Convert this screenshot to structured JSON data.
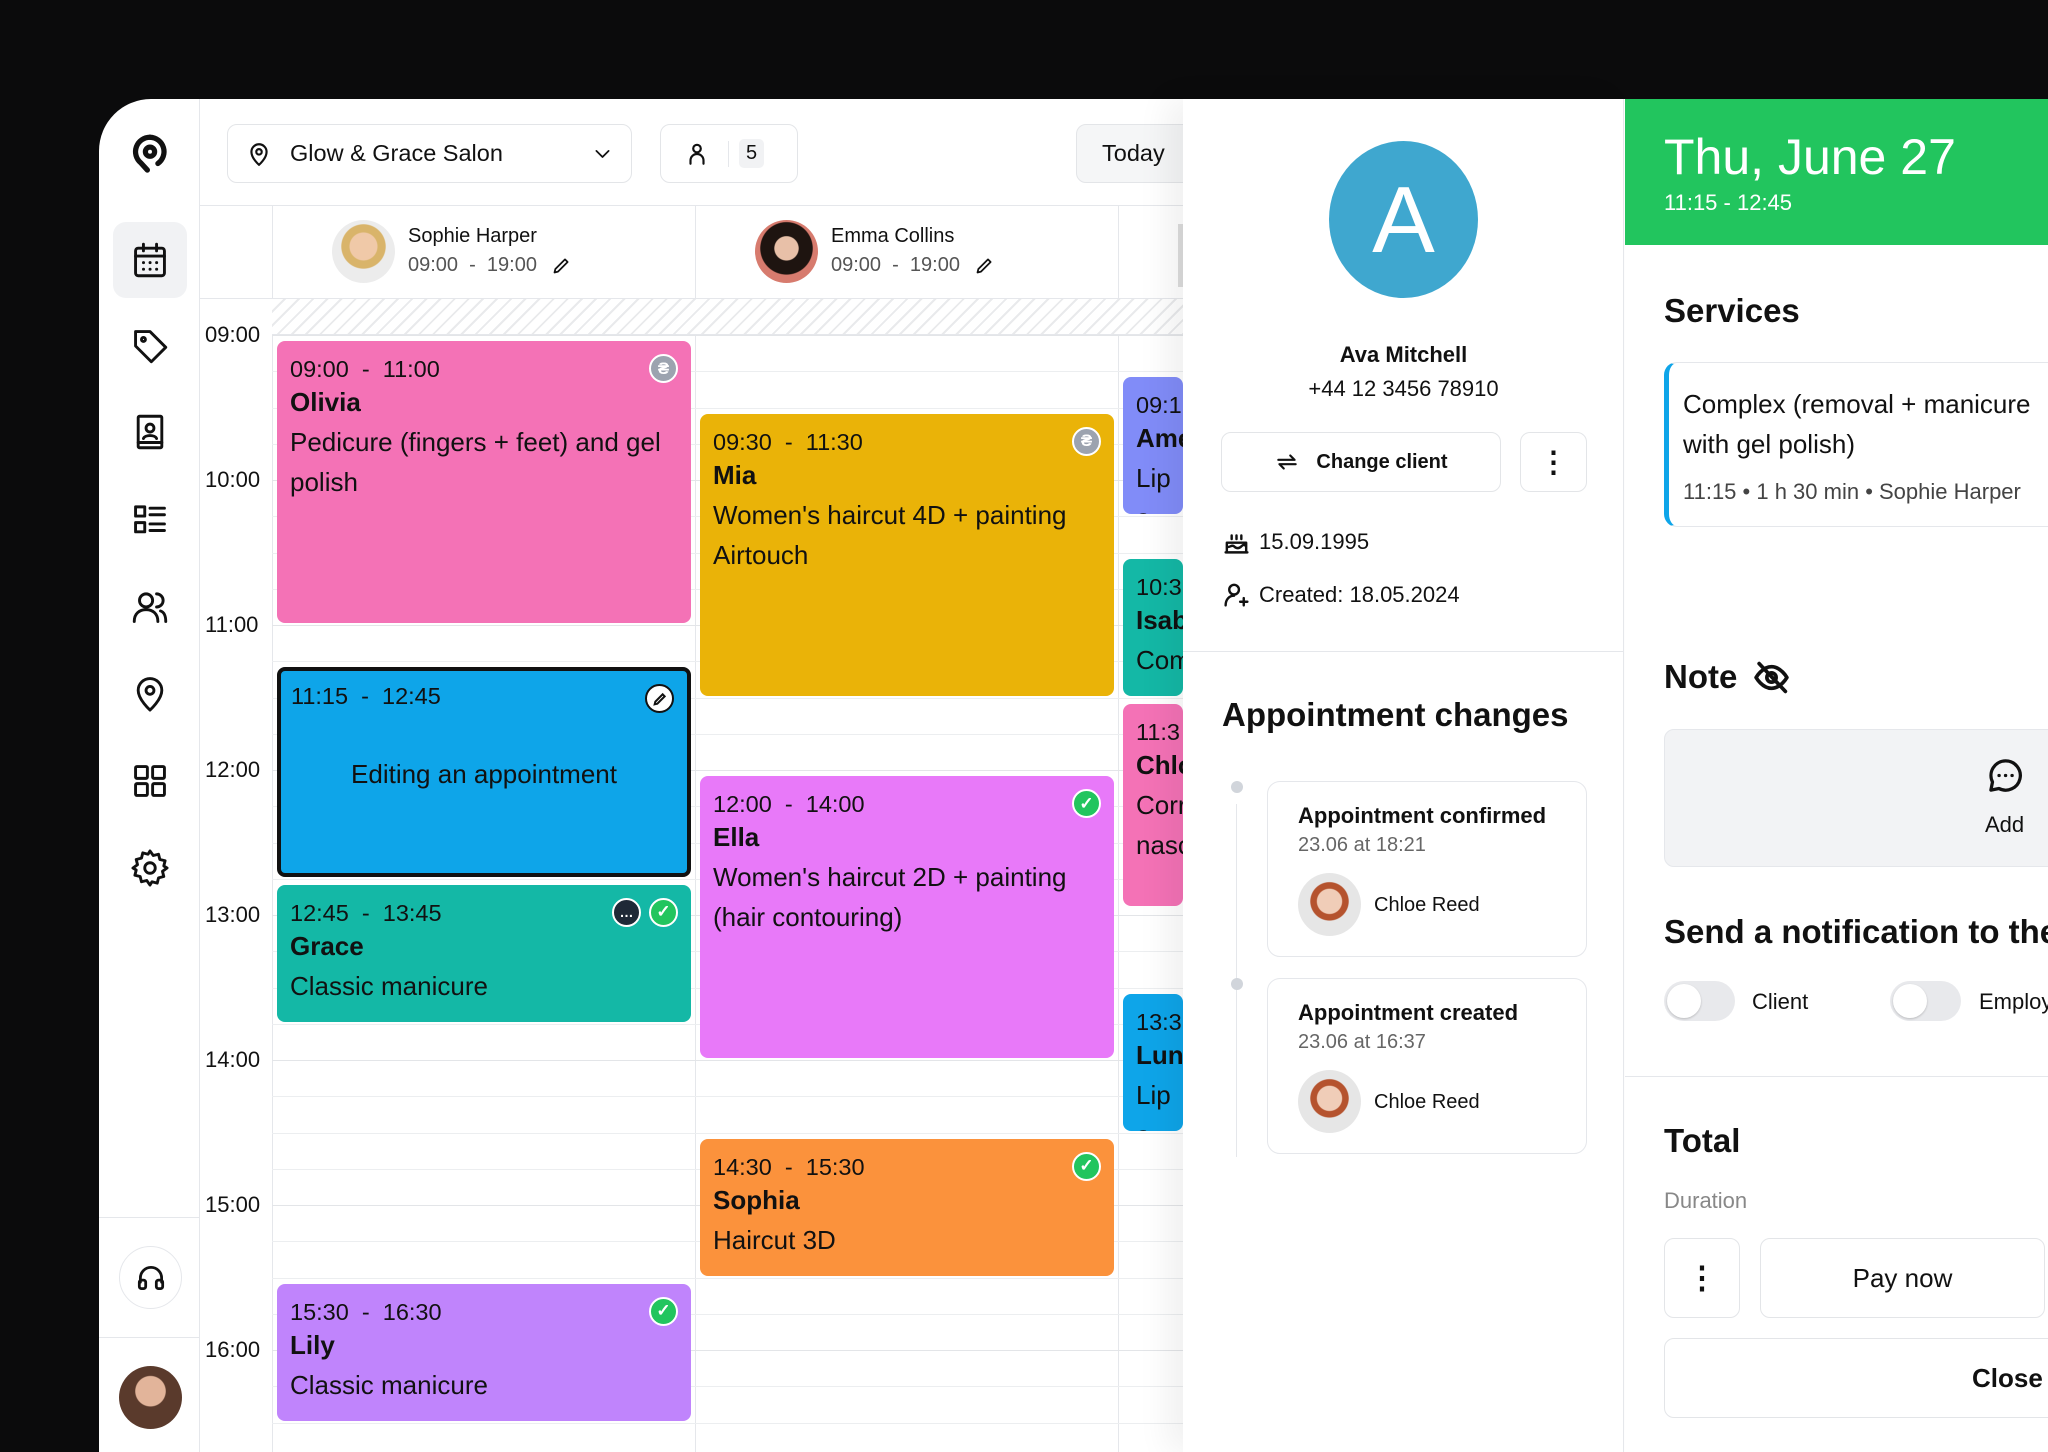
{
  "colors": {
    "background": "#0b0b0c",
    "accent_green": "#22c55e",
    "client_avatar": "#3fa7cf",
    "active_nav_bg": "#f1f2f4"
  },
  "sidebar": {
    "items": [
      {
        "icon": "logo-icon"
      },
      {
        "icon": "calendar-icon",
        "active": true
      },
      {
        "icon": "tag-icon"
      },
      {
        "icon": "contact-book-icon"
      },
      {
        "icon": "services-list-icon"
      },
      {
        "icon": "users-icon"
      },
      {
        "icon": "location-icon"
      },
      {
        "icon": "apps-grid-icon"
      },
      {
        "icon": "gear-icon"
      },
      {
        "icon": "headset-icon"
      },
      {
        "icon": "user-avatar"
      }
    ]
  },
  "toolbar": {
    "location": "Glow & Grace Salon",
    "staff_count": "5",
    "today_label": "Today"
  },
  "staff": [
    {
      "name": "Sophie Harper",
      "hours": "09:00  -  19:00"
    },
    {
      "name": "Emma Collins",
      "hours": "09:00  -  19:00"
    }
  ],
  "time_labels": [
    "09:00",
    "10:00",
    "11:00",
    "12:00",
    "13:00",
    "14:00",
    "15:00",
    "16:00"
  ],
  "events": [
    {
      "col": 0,
      "start": 9,
      "end": 11,
      "time": "09:00  -  11:00",
      "client": "Olivia",
      "service": "Pedicure (fingers + feet) and gel polish",
      "color": "#f472b6",
      "icons": [
        "payment"
      ]
    },
    {
      "col": 0,
      "start": 11.25,
      "end": 12.75,
      "time": "11:15  -  12:45",
      "client": "",
      "service": "Editing an appointment",
      "color": "#0ea5e9",
      "icons": [
        "edit"
      ],
      "editing": true
    },
    {
      "col": 0,
      "start": 12.75,
      "end": 13.75,
      "time": "12:45  -  13:45",
      "client": "Grace",
      "service": "Classic manicure",
      "color": "#14b8a6",
      "icons": [
        "comment",
        "check"
      ]
    },
    {
      "col": 0,
      "start": 15.5,
      "end": 16.5,
      "time": "15:30  -  16:30",
      "client": "Lily",
      "service": "Classic manicure",
      "color": "#c084fc",
      "icons": [
        "check"
      ]
    },
    {
      "col": 1,
      "start": 9.5,
      "end": 11.5,
      "time": "09:30  -  11:30",
      "client": "Mia",
      "service": "Women's haircut 4D + painting Airtouch",
      "color": "#eab308",
      "icons": [
        "payment"
      ]
    },
    {
      "col": 1,
      "start": 12,
      "end": 14,
      "time": "12:00  -  14:00",
      "client": "Ella",
      "service": "Women's haircut 2D + painting (hair contouring)",
      "color": "#e879f9",
      "icons": [
        "check"
      ]
    },
    {
      "col": 1,
      "start": 14.5,
      "end": 15.5,
      "time": "14:30  -  15:30",
      "client": "Sophia",
      "service": "Haircut 3D",
      "color": "#fb923c",
      "icons": [
        "check"
      ]
    },
    {
      "col": 2,
      "start": 9.25,
      "end": 10.25,
      "time": "09:1",
      "client": "Ame",
      "service": "Lip a",
      "color": "#818cf8",
      "icons": []
    },
    {
      "col": 2,
      "start": 10.5,
      "end": 11.5,
      "time": "10:3",
      "client": "Isab",
      "service": "Com",
      "color": "#14b8a6",
      "icons": []
    },
    {
      "col": 2,
      "start": 11.5,
      "end": 12.95,
      "time": "11:3",
      "client": "Chlo",
      "service": "Corr nasc",
      "color": "#f472b6",
      "icons": []
    },
    {
      "col": 2,
      "start": 13.5,
      "end": 14.5,
      "time": "13:3",
      "client": "Luna",
      "service": "Lip a",
      "color": "#0ea5e9",
      "icons": []
    }
  ],
  "client": {
    "initial": "A",
    "name": "Ava Mitchell",
    "phone": "+44 12 3456 78910",
    "change_label": "Change client",
    "birthday": "15.09.1995",
    "created": "Created: 18.05.2024"
  },
  "changes": {
    "title": "Appointment changes",
    "items": [
      {
        "title": "Appointment confirmed",
        "when": "23.06 at 18:21",
        "by": "Chloe Reed"
      },
      {
        "title": "Appointment created",
        "when": "23.06 at 16:37",
        "by": "Chloe Reed"
      }
    ]
  },
  "appointment": {
    "date": "Thu, June 27",
    "time": "11:15 - 12:45",
    "services_title": "Services",
    "service": {
      "name": "Complex (removal + manicure with gel polish)",
      "meta": "11:15 • 1 h 30 min • Sophie Harper"
    },
    "note_title": "Note",
    "note_add": "Add",
    "notify_title": "Send a notification to the",
    "notify_client": "Client",
    "notify_employee": "Employee",
    "total_title": "Total",
    "duration_label": "Duration",
    "pay_label": "Pay now",
    "close_label": "Close"
  }
}
